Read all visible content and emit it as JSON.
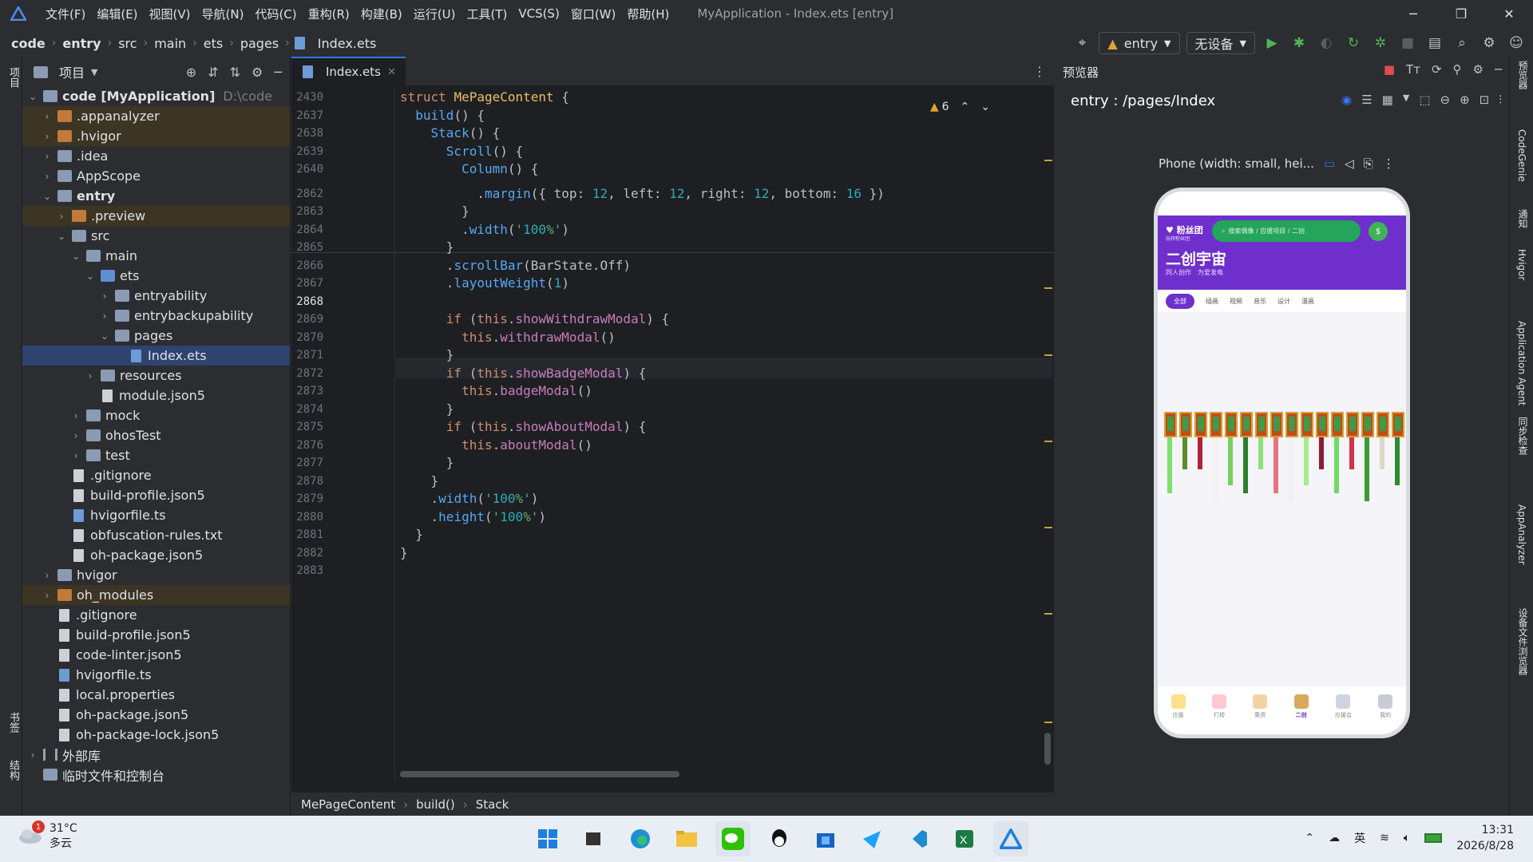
{
  "menubar": {
    "items": [
      "文件(F)",
      "编辑(E)",
      "视图(V)",
      "导航(N)",
      "代码(C)",
      "重构(R)",
      "构建(B)",
      "运行(U)",
      "工具(T)",
      "VCS(S)",
      "窗口(W)",
      "帮助(H)"
    ],
    "title": "MyApplication - Index.ets [entry]"
  },
  "toolbar": {
    "breadcrumbs": [
      "code",
      "entry",
      "src",
      "main",
      "ets",
      "pages",
      "Index.ets"
    ],
    "module_dropdown": "entry",
    "device_dropdown": "无设备"
  },
  "left_strip": {
    "project_label": "项目",
    "bookmarks_label": "书签",
    "structure_label": "结构"
  },
  "project_panel": {
    "title": "项目",
    "tree": [
      {
        "label": "code [MyApplication]",
        "extra": "D:\\code",
        "depth": 0,
        "chev": "v",
        "icon": "folder",
        "bold": true
      },
      {
        "label": ".appanalyzer",
        "depth": 1,
        "chev": ">",
        "icon": "folder-orange",
        "hl": true
      },
      {
        "label": ".hvigor",
        "depth": 1,
        "chev": ">",
        "icon": "folder-orange",
        "hl": true
      },
      {
        "label": ".idea",
        "depth": 1,
        "chev": ">",
        "icon": "folder"
      },
      {
        "label": "AppScope",
        "depth": 1,
        "chev": ">",
        "icon": "folder"
      },
      {
        "label": "entry",
        "depth": 1,
        "chev": "v",
        "icon": "folder",
        "bold": true
      },
      {
        "label": ".preview",
        "depth": 2,
        "chev": ">",
        "icon": "folder-orange",
        "hl": true
      },
      {
        "label": "src",
        "depth": 2,
        "chev": "v",
        "icon": "folder"
      },
      {
        "label": "main",
        "depth": 3,
        "chev": "v",
        "icon": "folder"
      },
      {
        "label": "ets",
        "depth": 4,
        "chev": "v",
        "icon": "folder-blue"
      },
      {
        "label": "entryability",
        "depth": 5,
        "chev": ">",
        "icon": "folder"
      },
      {
        "label": "entrybackupability",
        "depth": 5,
        "chev": ">",
        "icon": "folder"
      },
      {
        "label": "pages",
        "depth": 5,
        "chev": "v",
        "icon": "folder"
      },
      {
        "label": "Index.ets",
        "depth": 6,
        "chev": "",
        "icon": "file-ts",
        "sel": true
      },
      {
        "label": "resources",
        "depth": 4,
        "chev": ">",
        "icon": "folder"
      },
      {
        "label": "module.json5",
        "depth": 4,
        "chev": "",
        "icon": "file"
      },
      {
        "label": "mock",
        "depth": 3,
        "chev": ">",
        "icon": "folder"
      },
      {
        "label": "ohosTest",
        "depth": 3,
        "chev": ">",
        "icon": "folder"
      },
      {
        "label": "test",
        "depth": 3,
        "chev": ">",
        "icon": "folder"
      },
      {
        "label": ".gitignore",
        "depth": 2,
        "chev": "",
        "icon": "file"
      },
      {
        "label": "build-profile.json5",
        "depth": 2,
        "chev": "",
        "icon": "file"
      },
      {
        "label": "hvigorfile.ts",
        "depth": 2,
        "chev": "",
        "icon": "file-ts"
      },
      {
        "label": "obfuscation-rules.txt",
        "depth": 2,
        "chev": "",
        "icon": "file"
      },
      {
        "label": "oh-package.json5",
        "depth": 2,
        "chev": "",
        "icon": "file"
      },
      {
        "label": "hvigor",
        "depth": 1,
        "chev": ">",
        "icon": "folder"
      },
      {
        "label": "oh_modules",
        "depth": 1,
        "chev": ">",
        "icon": "folder-orange",
        "hl": true
      },
      {
        "label": ".gitignore",
        "depth": 1,
        "chev": "",
        "icon": "file"
      },
      {
        "label": "build-profile.json5",
        "depth": 1,
        "chev": "",
        "icon": "file"
      },
      {
        "label": "code-linter.json5",
        "depth": 1,
        "chev": "",
        "icon": "file"
      },
      {
        "label": "hvigorfile.ts",
        "depth": 1,
        "chev": "",
        "icon": "file-ts"
      },
      {
        "label": "local.properties",
        "depth": 1,
        "chev": "",
        "icon": "file"
      },
      {
        "label": "oh-package.json5",
        "depth": 1,
        "chev": "",
        "icon": "file"
      },
      {
        "label": "oh-package-lock.json5",
        "depth": 1,
        "chev": "",
        "icon": "file"
      },
      {
        "label": "外部库",
        "depth": 0,
        "chev": ">",
        "icon": "lib"
      },
      {
        "label": "临时文件和控制台",
        "depth": 0,
        "chev": "",
        "icon": "console"
      }
    ]
  },
  "editor": {
    "tab_label": "Index.ets",
    "warning_count": "6",
    "lines": [
      {
        "n": "2430",
        "t": "struct MePageContent {"
      },
      {
        "n": "2637",
        "t": "  build() {"
      },
      {
        "n": "2638",
        "t": "    Stack() {"
      },
      {
        "n": "2639",
        "t": "      Scroll() {"
      },
      {
        "n": "2640",
        "t": "        Column() {"
      },
      {
        "n": "2862",
        "t": "          .margin({ top: 12, left: 12, right: 12, bottom: 16 })"
      },
      {
        "n": "2863",
        "t": "        }"
      },
      {
        "n": "2864",
        "t": "        .width('100%')"
      },
      {
        "n": "2865",
        "t": "      }"
      },
      {
        "n": "2866",
        "t": "      .scrollBar(BarState.Off)"
      },
      {
        "n": "2867",
        "t": "      .layoutWeight(1)"
      },
      {
        "n": "2868",
        "t": ""
      },
      {
        "n": "2869",
        "t": "      if (this.showWithdrawModal) {"
      },
      {
        "n": "2870",
        "t": "        this.withdrawModal()"
      },
      {
        "n": "2871",
        "t": "      }"
      },
      {
        "n": "2872",
        "t": "      if (this.showBadgeModal) {"
      },
      {
        "n": "2873",
        "t": "        this.badgeModal()"
      },
      {
        "n": "2874",
        "t": "      }"
      },
      {
        "n": "2875",
        "t": "      if (this.showAboutModal) {"
      },
      {
        "n": "2876",
        "t": "        this.aboutModal()"
      },
      {
        "n": "2877",
        "t": "      }"
      },
      {
        "n": "2878",
        "t": "    }"
      },
      {
        "n": "2879",
        "t": "    .width('100%')"
      },
      {
        "n": "2880",
        "t": "    .height('100%')"
      },
      {
        "n": "2881",
        "t": "  }"
      },
      {
        "n": "2882",
        "t": "}"
      },
      {
        "n": "2883",
        "t": ""
      }
    ],
    "breadcrumb": [
      "MePageContent",
      "build()",
      "Stack"
    ]
  },
  "previewer": {
    "title": "预览器",
    "path": "entry : /pages/Index",
    "device_label": "Phone (width: small, hei...",
    "app": {
      "brand": "粉丝团",
      "brand_sub": "玩转粉丝团",
      "search_placeholder": "搜索偶像 / 应援项目 / 二创",
      "title": "二创宇宙",
      "meta": [
        "同人创作",
        "为爱发电"
      ],
      "tabs": [
        "全部",
        "插画",
        "视频",
        "音乐",
        "设计",
        "漫画"
      ],
      "nav": [
        "应援",
        "打榜",
        "集资",
        "二创",
        "应援会",
        "我的"
      ]
    }
  },
  "right_strip": [
    "预览器",
    "CodeGenie",
    "通知",
    "Hvigor",
    "Application Agent",
    "同步检查",
    "AppAnalyzer",
    "设备文件浏览器"
  ],
  "taskbar": {
    "temperature": "31°C",
    "weather": "多云",
    "badge": "1",
    "ime": "英",
    "time": "13:31",
    "date": "2026/8/28"
  }
}
